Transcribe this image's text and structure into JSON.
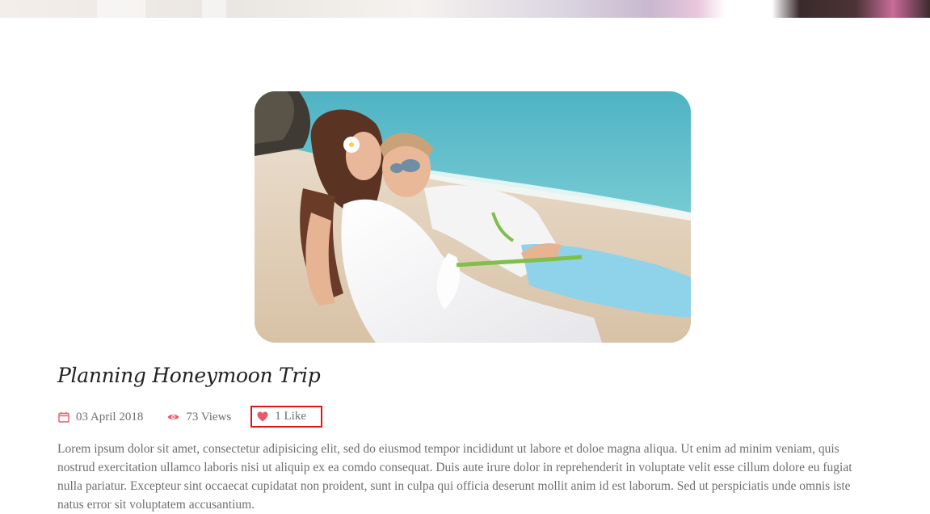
{
  "banner": {
    "icon": "decorative-banner-image"
  },
  "hero": {
    "icon": "couple-on-beach-photo"
  },
  "post": {
    "title": "Planning Honeymoon Trip",
    "date": "03 April 2018",
    "views": "73 Views",
    "likes": "1 Like",
    "excerpt": "Lorem ipsum dolor sit amet, consectetur adipisicing elit, sed do eiusmod tempor incididunt ut labore et doloe magna aliqua. Ut enim ad minim veniam, quis nostrud exercitation ullamco laboris nisi ut aliquip ex ea comdo consequat. Duis aute irure dolor in reprehenderit in voluptate velit esse cillum dolore eu fugiat nulla pariatur. Excepteur sint occaecat cupidatat non proident, sunt in culpa qui officia deserunt mollit anim id est laborum. Sed ut perspiciatis unde omnis iste natus error sit voluptatem accusantium."
  },
  "icons": {
    "date": "calendar-icon",
    "views": "eye-icon",
    "likes": "heart-icon"
  },
  "colors": {
    "accent": "#e85a6b",
    "text": "#6e6e6e",
    "title": "#222222",
    "highlight_box": "#e51414"
  }
}
